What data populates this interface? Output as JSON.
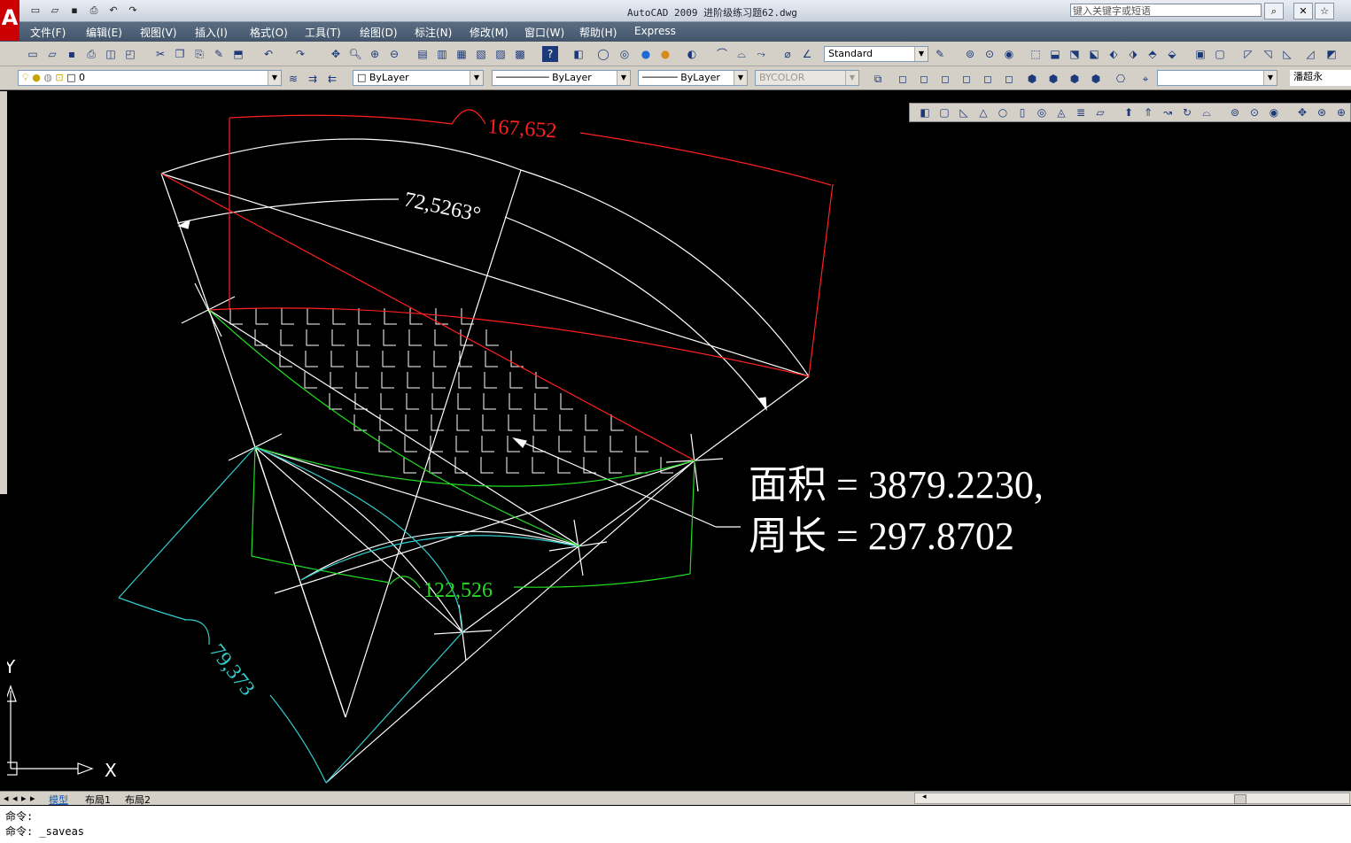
{
  "window": {
    "title": "AutoCAD 2009  进阶级练习题62.dwg",
    "search_placeholder": "键入关键字或短语",
    "logo": "A"
  },
  "menu": [
    "文件(F)",
    "编辑(E)",
    "视图(V)",
    "插入(I)",
    "格式(O)",
    "工具(T)",
    "绘图(D)",
    "标注(N)",
    "修改(M)",
    "窗口(W)",
    "帮助(H)",
    "Express"
  ],
  "toolbar": {
    "text_style": "Standard",
    "layer": "0",
    "color": "ByLayer",
    "linetype": "ByLayer",
    "lineweight": "ByLayer",
    "plotstyle": "BYCOLOR",
    "user": "潘超永"
  },
  "drawing": {
    "dim_red": "167,652",
    "dim_angle": "72,5263°",
    "dim_green": "122,526",
    "dim_cyan": "79,373",
    "area_line": "面积 = 3879.2230,",
    "perimeter_line": "周长 = 297.8702"
  },
  "ucs": {
    "y_label": "Y",
    "x_label": "X"
  },
  "tabs": [
    "模型",
    "布局1",
    "布局2"
  ],
  "command_lines": [
    "命令:",
    "命令: _saveas"
  ],
  "colors": {
    "red": "#ff2020",
    "green": "#22dd22",
    "cyan": "#33cccc",
    "white": "#ffffff"
  }
}
